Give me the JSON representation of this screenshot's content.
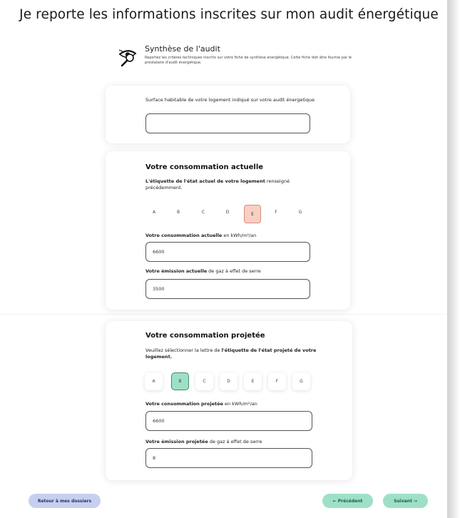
{
  "page": {
    "title": "Je reporte les informations inscrites sur mon audit énergétique"
  },
  "audit": {
    "title": "Synthèse de l'audit",
    "description": "Reportez les critères techniques inscrits sur votre fiche de synthèse énergétique. Cette fiche doit être fournie par le prestataire d'audit énergétique.",
    "icon": "eye-magnifier-icon"
  },
  "surface": {
    "label": "Surface habitable de votre logement indiqué sur votre audit énergetique",
    "value": ""
  },
  "current": {
    "title": "Votre consommation actuelle",
    "label_bold": "L'étiquette de l'état actuel de votre logement",
    "label_rest": " renseigné précédemment.",
    "letters": [
      "A",
      "B",
      "C",
      "D",
      "E",
      "F",
      "G"
    ],
    "selected_letter": "E",
    "consumption_label_bold": "Votre consommation actuelle",
    "consumption_label_rest": " en kWh/m²/an",
    "consumption_value": "6600",
    "emission_label_bold": "Votre émission actuelle",
    "emission_label_rest": " de gaz à effet de serre",
    "emission_value": "3500"
  },
  "projected": {
    "title": "Votre consommation projetée",
    "label_plain": "Veuillez sélectionner la lettre de ",
    "label_bold": "l'étiquette de l'état projeté de votre logement.",
    "letters": [
      "A",
      "B",
      "C",
      "D",
      "E",
      "F",
      "G"
    ],
    "selected_letter": "B",
    "consumption_label_bold": "Votre consommation projetée",
    "consumption_label_rest": " en kWh/m²/an",
    "consumption_value": "6600",
    "emission_label_bold": "Votre émission projetée",
    "emission_label_rest": " de gaz à effet de serre",
    "emission_value": "8"
  },
  "footer": {
    "back_label": "Retour à mes dossiers",
    "prev_label": "← Précédent",
    "next_label": "Suivant →"
  },
  "colors": {
    "accent_green": "#9ee0c6",
    "accent_red": "#f8cfc3",
    "accent_blue": "#c6d0ee"
  }
}
